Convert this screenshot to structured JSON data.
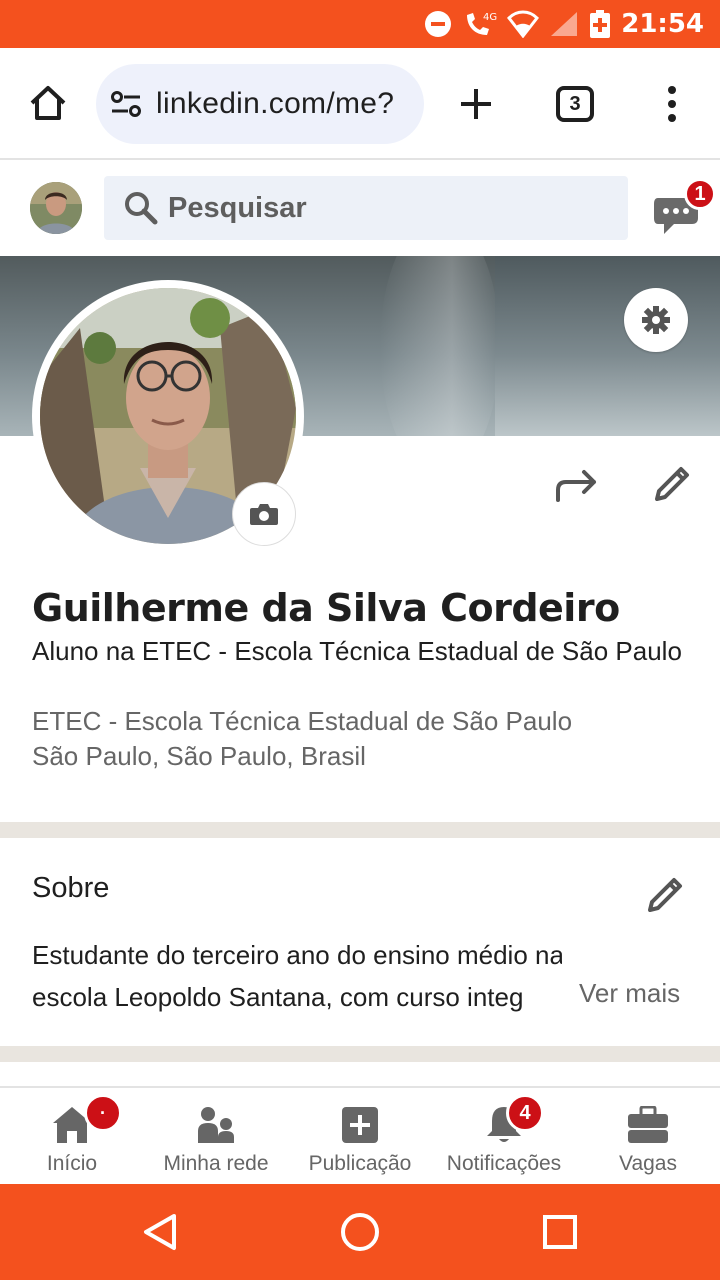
{
  "status_bar": {
    "time": "21:54",
    "network": "4G"
  },
  "browser": {
    "url": "linkedin.com/me?",
    "tab_count": "3"
  },
  "linkedin_header": {
    "search_placeholder": "Pesquisar",
    "messages_badge": "1"
  },
  "profile": {
    "name": "Guilherme da Silva Cordeiro",
    "headline": "Aluno na ETEC - Escola Técnica Estadual de São Paulo",
    "company": "ETEC - Escola Técnica Estadual de São Paulo",
    "location": "São Paulo, São Paulo, Brasil"
  },
  "about": {
    "title": "Sobre",
    "line1": "Estudante do terceiro ano do ensino médio na",
    "line2": "escola Leopoldo Santana, com curso integ",
    "see_more": "Ver mais"
  },
  "bottom_nav": {
    "items": [
      {
        "label": "Início",
        "icon": "home-icon",
        "badge": "·"
      },
      {
        "label": "Minha rede",
        "icon": "network-icon",
        "badge": ""
      },
      {
        "label": "Publicação",
        "icon": "post-icon",
        "badge": ""
      },
      {
        "label": "Notificações",
        "icon": "bell-icon",
        "badge": "4"
      },
      {
        "label": "Vagas",
        "icon": "briefcase-icon",
        "badge": ""
      }
    ]
  },
  "colors": {
    "status_bar": "#f4511e",
    "badge": "#cc1016",
    "icon_gray": "#666666"
  }
}
